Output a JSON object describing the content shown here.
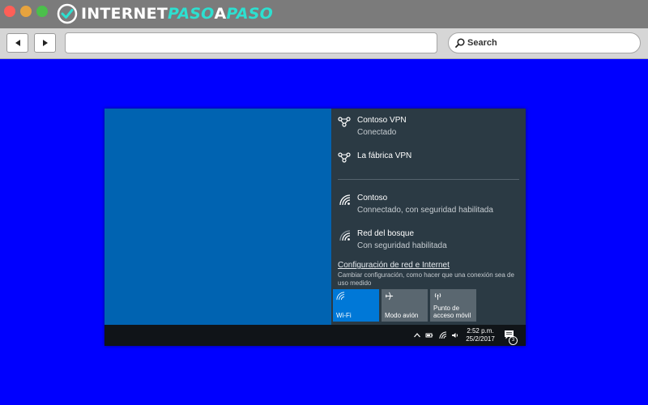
{
  "browser": {
    "logo": {
      "text_a": "INTERNET",
      "text_b": "PASO",
      "text_c": "A",
      "text_d": "PASO"
    },
    "nav": {
      "back_icon": "back-arrow-icon",
      "forward_icon": "forward-arrow-icon"
    },
    "url": "",
    "search": {
      "placeholder": "Search"
    }
  },
  "network_panel": {
    "vpns": [
      {
        "name": "Contoso VPN",
        "status": "Conectado",
        "icon": "vpn-icon"
      },
      {
        "name": "La fábrica VPN",
        "status": "",
        "icon": "vpn-icon"
      }
    ],
    "wifi": [
      {
        "name": "Contoso",
        "status": "Connectado, con seguridad habilitada",
        "icon": "wifi-icon"
      },
      {
        "name": "Red del bosque",
        "status": "Con seguridad habilitada",
        "icon": "wifi-icon"
      }
    ],
    "settings_link": "Configuración de red e Internet",
    "settings_desc": "Cambiar configuración, como hacer que una conexión sea de uso medido",
    "tiles": [
      {
        "label": "Wi-Fi",
        "active": true,
        "icon": "wifi-icon"
      },
      {
        "label": "Modo avión",
        "active": false,
        "icon": "airplane-icon"
      },
      {
        "label": "Punto de acceso móvil",
        "active": false,
        "icon": "hotspot-icon"
      }
    ]
  },
  "taskbar": {
    "time": "2:52 p.m.",
    "date": "25/2/2017",
    "notification_count": "3"
  },
  "colors": {
    "page_bg": "#0000ff",
    "desktop": "#0063b1",
    "panel": "#2b3a44",
    "tile_active": "#0078d7",
    "tile_inactive": "#5a6770",
    "taskbar": "#101418"
  }
}
